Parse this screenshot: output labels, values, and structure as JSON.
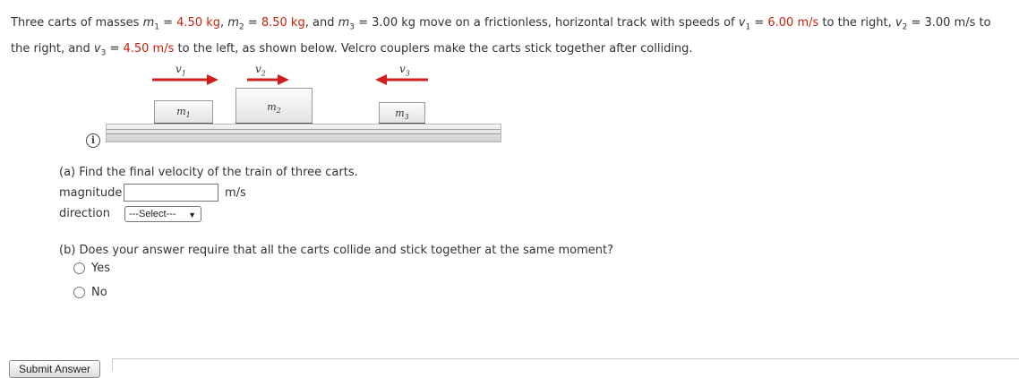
{
  "problem": {
    "t1": "Three carts of masses ",
    "m1_sym": "m",
    "m1_sub": "1",
    "eq1": " = ",
    "m1_val": "4.50 kg",
    "sep1": ", ",
    "m2_sym": "m",
    "m2_sub": "2",
    "eq2": " = ",
    "m2_val": "8.50 kg",
    "sep2": ", and ",
    "m3_sym": "m",
    "m3_sub": "3",
    "eq3": " = ",
    "m3_val": "3.00 kg",
    "t2": " move on a frictionless, horizontal track with speeds of ",
    "v1_sym": "v",
    "v1_sub": "1",
    "eq4": " = ",
    "v1_val": "6.00 m/s",
    "t3": " to the right, ",
    "v2_sym": "v",
    "v2_sub": "2",
    "eq5": " = ",
    "v2_val": "3.00 m/s",
    "t4": " to the right, and ",
    "v3_sym": "v",
    "v3_sub": "3",
    "eq6": " = ",
    "v3_val": "4.50 m/s",
    "t5": " to the left, as shown below. Velcro couplers make the carts stick together after colliding."
  },
  "figure": {
    "v": "v",
    "v1_sub": "1",
    "v2_sub": "2",
    "v3_sub": "3",
    "m": "m",
    "m1_sub": "1",
    "m2_sub": "2",
    "m3_sub": "3",
    "arrow_color": "#d11e1e"
  },
  "part_a": {
    "question": "(a) Find the final velocity of the train of three carts.",
    "magnitude_label": "magnitude",
    "magnitude_value": "",
    "units": "m/s",
    "direction_label": "direction",
    "direction_selected": "---Select---"
  },
  "part_b": {
    "question": "(b) Does your answer require that all the carts collide and stick together at the same moment?",
    "options": [
      "Yes",
      "No"
    ]
  },
  "submit_label": "Submit Answer",
  "icons": {
    "info": "info-icon",
    "dropdown": "chevron-down-icon"
  },
  "colors": {
    "given_value": "#c9210f",
    "arrow": "#d11e1e"
  }
}
